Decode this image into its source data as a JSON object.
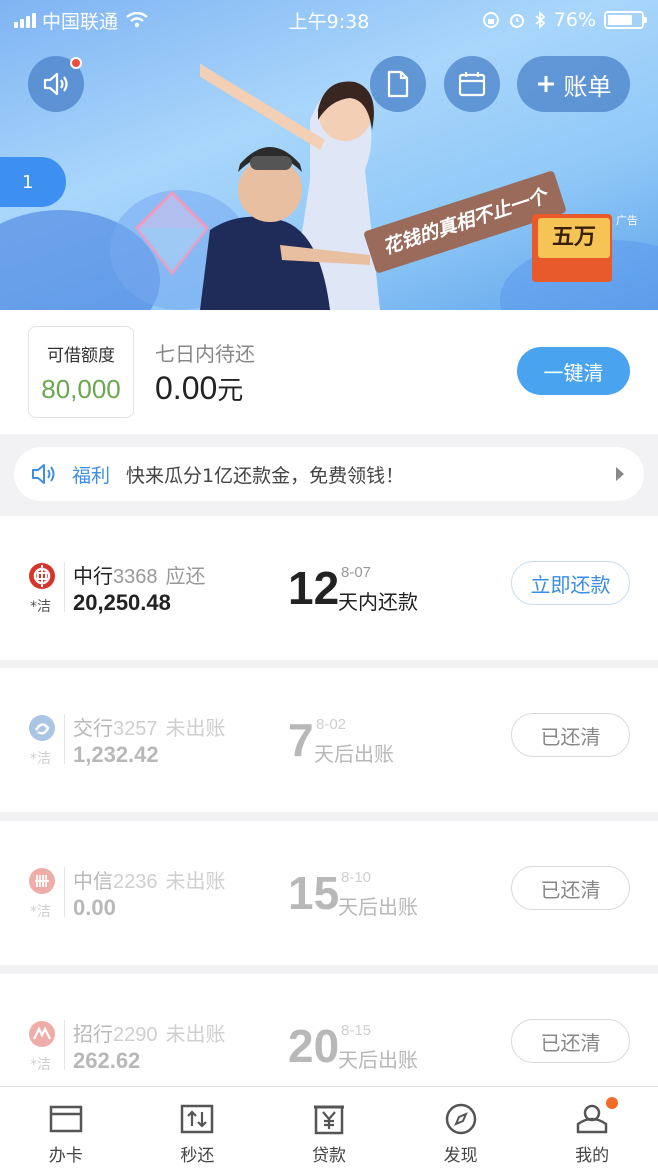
{
  "status_bar": {
    "carrier": "中国联通",
    "time": "上午9:38",
    "battery": "76%",
    "battery_level": 0.76
  },
  "banner": {
    "slogan": "花钱的真相不止一个",
    "prize": "五万",
    "ad_label": "广告",
    "page_indicator": "1",
    "add_bill_label": "账单"
  },
  "summary": {
    "quota_label": "可借额度",
    "quota_value": "80,000",
    "due_label": "七日内待还",
    "due_value": "0.00",
    "due_unit": "元",
    "clear_button": "一键清"
  },
  "notice": {
    "tag": "福利",
    "text": "快来瓜分1亿还款金，免费领钱！"
  },
  "cards": [
    {
      "bank": "中行",
      "number": "3368",
      "status": "应还",
      "amount": "20,250.48",
      "days": "12",
      "date": "8-07",
      "day_label": "天内还款",
      "action": "立即还款",
      "clean_tag": "*洁",
      "color": "#d9342b"
    },
    {
      "bank": "交行",
      "number": "3257",
      "status": "未出账",
      "amount": "1,232.42",
      "days": "7",
      "date": "8-02",
      "day_label": "天后出账",
      "action": "已还清",
      "clean_tag": "*洁",
      "color": "#2f6fbf"
    },
    {
      "bank": "中信",
      "number": "2236",
      "status": "未出账",
      "amount": "0.00",
      "days": "15",
      "date": "8-10",
      "day_label": "天后出账",
      "action": "已还清",
      "clean_tag": "*洁",
      "color": "#d9342b"
    },
    {
      "bank": "招行",
      "number": "2290",
      "status": "未出账",
      "amount": "262.62",
      "days": "20",
      "date": "8-15",
      "day_label": "天后出账",
      "action": "已还清",
      "clean_tag": "*洁",
      "color": "#d9342b"
    }
  ],
  "tabs": [
    {
      "label": "办卡",
      "icon": "card-icon"
    },
    {
      "label": "秒还",
      "icon": "exchange-icon"
    },
    {
      "label": "贷款",
      "icon": "yuan-icon"
    },
    {
      "label": "发现",
      "icon": "compass-icon"
    },
    {
      "label": "我的",
      "icon": "user-icon"
    }
  ]
}
